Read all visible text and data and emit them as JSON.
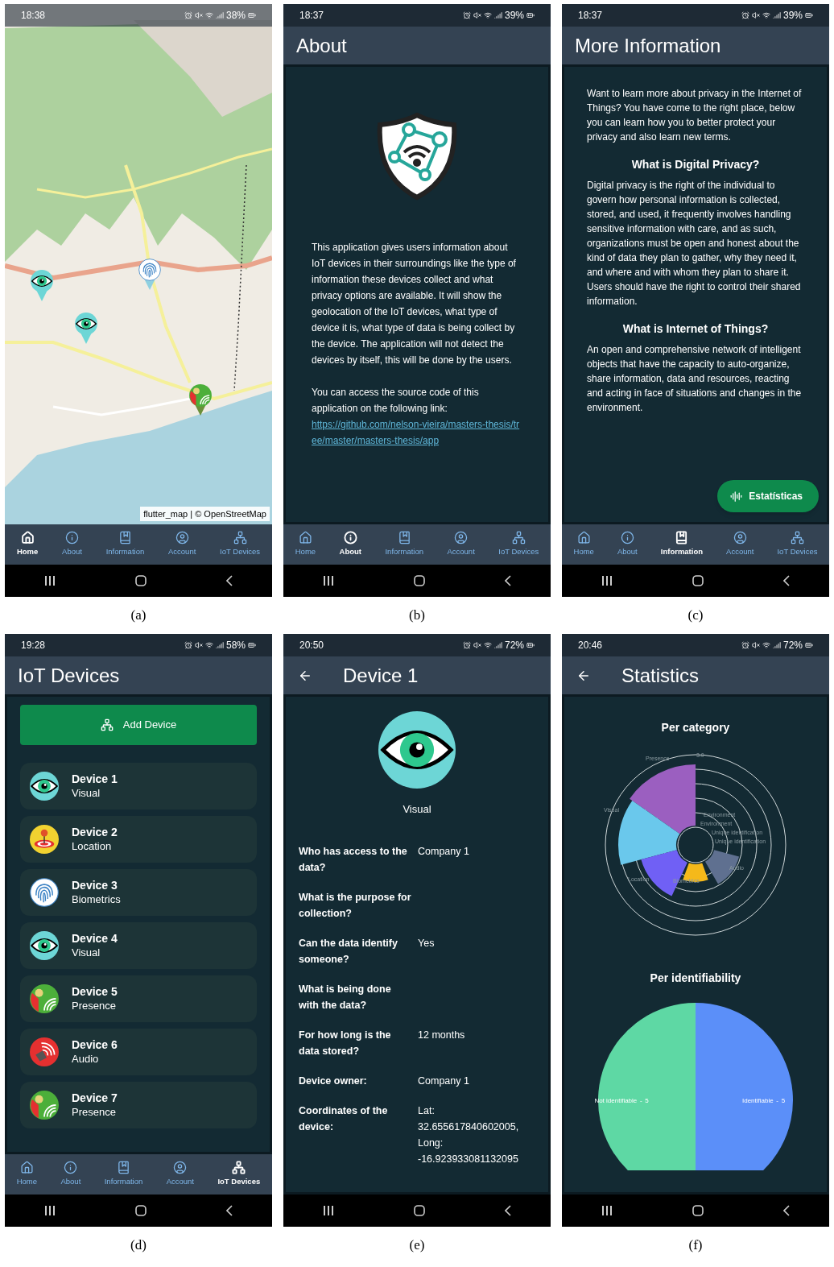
{
  "panels": [
    {
      "kind": "map",
      "caption": "(a)",
      "status": {
        "time": "18:38",
        "battery": "38%"
      },
      "attribution": "flutter_map | © OpenStreetMap",
      "markers": [
        {
          "kind": "visual"
        },
        {
          "kind": "visual"
        },
        {
          "kind": "biometrics"
        },
        {
          "kind": "presence"
        }
      ],
      "nav": [
        {
          "kind": "home",
          "label": "Home",
          "selected": true
        },
        {
          "kind": "about",
          "label": "About",
          "selected": false
        },
        {
          "kind": "information",
          "label": "Information",
          "selected": false
        },
        {
          "kind": "account",
          "label": "Account",
          "selected": false
        },
        {
          "kind": "devices",
          "label": "IoT Devices",
          "selected": false
        }
      ]
    },
    {
      "kind": "about",
      "caption": "(b)",
      "status": {
        "time": "18:37",
        "battery": "39%"
      },
      "title": "About",
      "paragraphs": [
        "This application gives users information about IoT devices in their surroundings like the type of information these devices collect and what privacy options are available. It will show the geolocation of the IoT devices, what type of device it is, what type of data is being collect by the device. The application will not detect the devices by itself, this will be done by the users.",
        "You can access the source code of this application on the following link:"
      ],
      "link": "https://github.com/nelson-vieira/masters-thesis/tree/master/masters-thesis/app",
      "nav": [
        {
          "kind": "home",
          "label": "Home",
          "selected": false
        },
        {
          "kind": "about",
          "label": "About",
          "selected": true
        },
        {
          "kind": "information",
          "label": "Information",
          "selected": false
        },
        {
          "kind": "account",
          "label": "Account",
          "selected": false
        },
        {
          "kind": "devices",
          "label": "IoT Devices",
          "selected": false
        }
      ]
    },
    {
      "kind": "info",
      "caption": "(c)",
      "status": {
        "time": "18:37",
        "battery": "39%"
      },
      "title": "More Information",
      "intro": "Want to learn more about privacy in the Internet of Things? You have come to the right place, below you can learn how you to better protect your privacy and also learn new terms.",
      "sections": [
        {
          "heading": "What is Digital Privacy?",
          "body": "Digital privacy is the right of the individual to govern how personal information is collected, stored, and used, it frequently involves handling sensitive information with care, and as such, organizations must be open and honest about the kind of data they plan to gather, why they need it, and where and with whom they plan to share it. Users should have the right to control their shared information."
        },
        {
          "heading": "What is Internet of Things?",
          "body": "An open and comprehensive network of intelligent objects that have the capacity to auto-organize, share information, data and resources, reacting and acting in face of situations and changes in the environment."
        }
      ],
      "fab": "Estatísticas",
      "nav": [
        {
          "kind": "home",
          "label": "Home",
          "selected": false
        },
        {
          "kind": "about",
          "label": "About",
          "selected": false
        },
        {
          "kind": "information",
          "label": "Information",
          "selected": true
        },
        {
          "kind": "account",
          "label": "Account",
          "selected": false
        },
        {
          "kind": "devices",
          "label": "IoT Devices",
          "selected": false
        }
      ]
    },
    {
      "kind": "devices",
      "caption": "(d)",
      "status": {
        "time": "19:28",
        "battery": "58%"
      },
      "title": "IoT Devices",
      "add_button": "Add Device",
      "devices": [
        {
          "name": "Device 1",
          "type": "Visual",
          "kind": "visual"
        },
        {
          "name": "Device 2",
          "type": "Location",
          "kind": "location"
        },
        {
          "name": "Device 3",
          "type": "Biometrics",
          "kind": "biometrics"
        },
        {
          "name": "Device 4",
          "type": "Visual",
          "kind": "visual"
        },
        {
          "name": "Device 5",
          "type": "Presence",
          "kind": "presence"
        },
        {
          "name": "Device 6",
          "type": "Audio",
          "kind": "audio"
        },
        {
          "name": "Device 7",
          "type": "Presence",
          "kind": "presence"
        }
      ],
      "nav": [
        {
          "kind": "home",
          "label": "Home",
          "selected": false
        },
        {
          "kind": "about",
          "label": "About",
          "selected": false
        },
        {
          "kind": "information",
          "label": "Information",
          "selected": false
        },
        {
          "kind": "account",
          "label": "Account",
          "selected": false
        },
        {
          "kind": "devices",
          "label": "IoT Devices",
          "selected": true
        }
      ]
    },
    {
      "kind": "device",
      "caption": "(e)",
      "status": {
        "time": "20:50",
        "battery": "72%"
      },
      "title": "Device 1",
      "back": true,
      "device": {
        "kind": "visual",
        "type": "Visual"
      },
      "fields": [
        {
          "label": "Who has access to the data?",
          "value": "Company 1"
        },
        {
          "label": "What is the purpose for collection?"
        },
        {
          "label": "Can the data identify someone?",
          "value": "Yes"
        },
        {
          "label": "What is being done with the data?"
        },
        {
          "label": "For how long is the data stored?",
          "value": "12 months"
        },
        {
          "label": "Device owner:",
          "value": "Company 1"
        },
        {
          "label": "Coordinates of the device:",
          "value": "Lat: 32.655617840602005, Long: -16.923933081132095"
        }
      ]
    },
    {
      "kind": "stats",
      "caption": "(f)",
      "status": {
        "time": "20:46",
        "battery": "72%"
      },
      "title": "Statistics",
      "back": true,
      "polar": {
        "title": "Per category",
        "tick": "3.0",
        "labels": [
          "Presence",
          "Visual",
          "Location",
          "Biometrics",
          "Audio",
          "Environment",
          "Environment",
          "Unique identification",
          "Unique identification"
        ]
      },
      "pie": {
        "label_separator": "-",
        "chart_data": {
          "type": "pie",
          "title": "Per identifiability",
          "categories": [
            "Not identifiable",
            "Identifiable"
          ],
          "values": [
            5,
            5
          ],
          "data_labels": true
        }
      }
    }
  ]
}
